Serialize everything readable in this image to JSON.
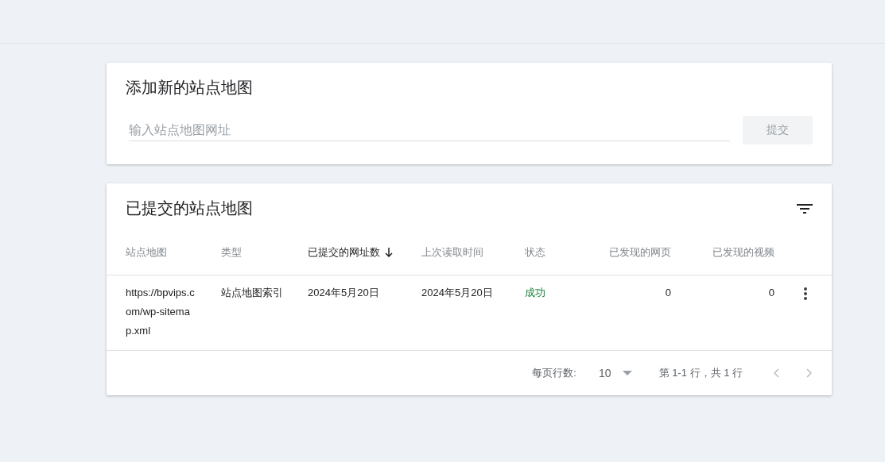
{
  "add_card": {
    "title": "添加新的站点地图",
    "input": {
      "placeholder": "输入站点地图网址"
    },
    "submit": {
      "label": "提交",
      "disabled": true
    }
  },
  "table_card": {
    "title": "已提交的站点地图",
    "columns": [
      {
        "label": "站点地图",
        "sorted": false,
        "numeric": false
      },
      {
        "label": "类型",
        "sorted": false,
        "numeric": false
      },
      {
        "label": "已提交的网址数",
        "sorted": true,
        "numeric": false
      },
      {
        "label": "上次读取时间",
        "sorted": false,
        "numeric": false
      },
      {
        "label": "状态",
        "sorted": false,
        "numeric": false
      },
      {
        "label": "已发现的网页",
        "sorted": false,
        "numeric": true
      },
      {
        "label": "已发现的视频",
        "sorted": false,
        "numeric": true
      }
    ],
    "rows": [
      {
        "cells": [
          "https://bpvips.com/wp-sitemap.xml",
          "站点地图索引",
          "2024年5月20日",
          "2024年5月20日",
          "成功",
          "0",
          "0"
        ],
        "status_ok": true
      }
    ],
    "pagination": {
      "rows_per_page_label": "每页行数:",
      "rows_per_page": "10",
      "range": "第 1-1 行，共 1 行",
      "prev_disabled": true,
      "next_disabled": true
    }
  }
}
